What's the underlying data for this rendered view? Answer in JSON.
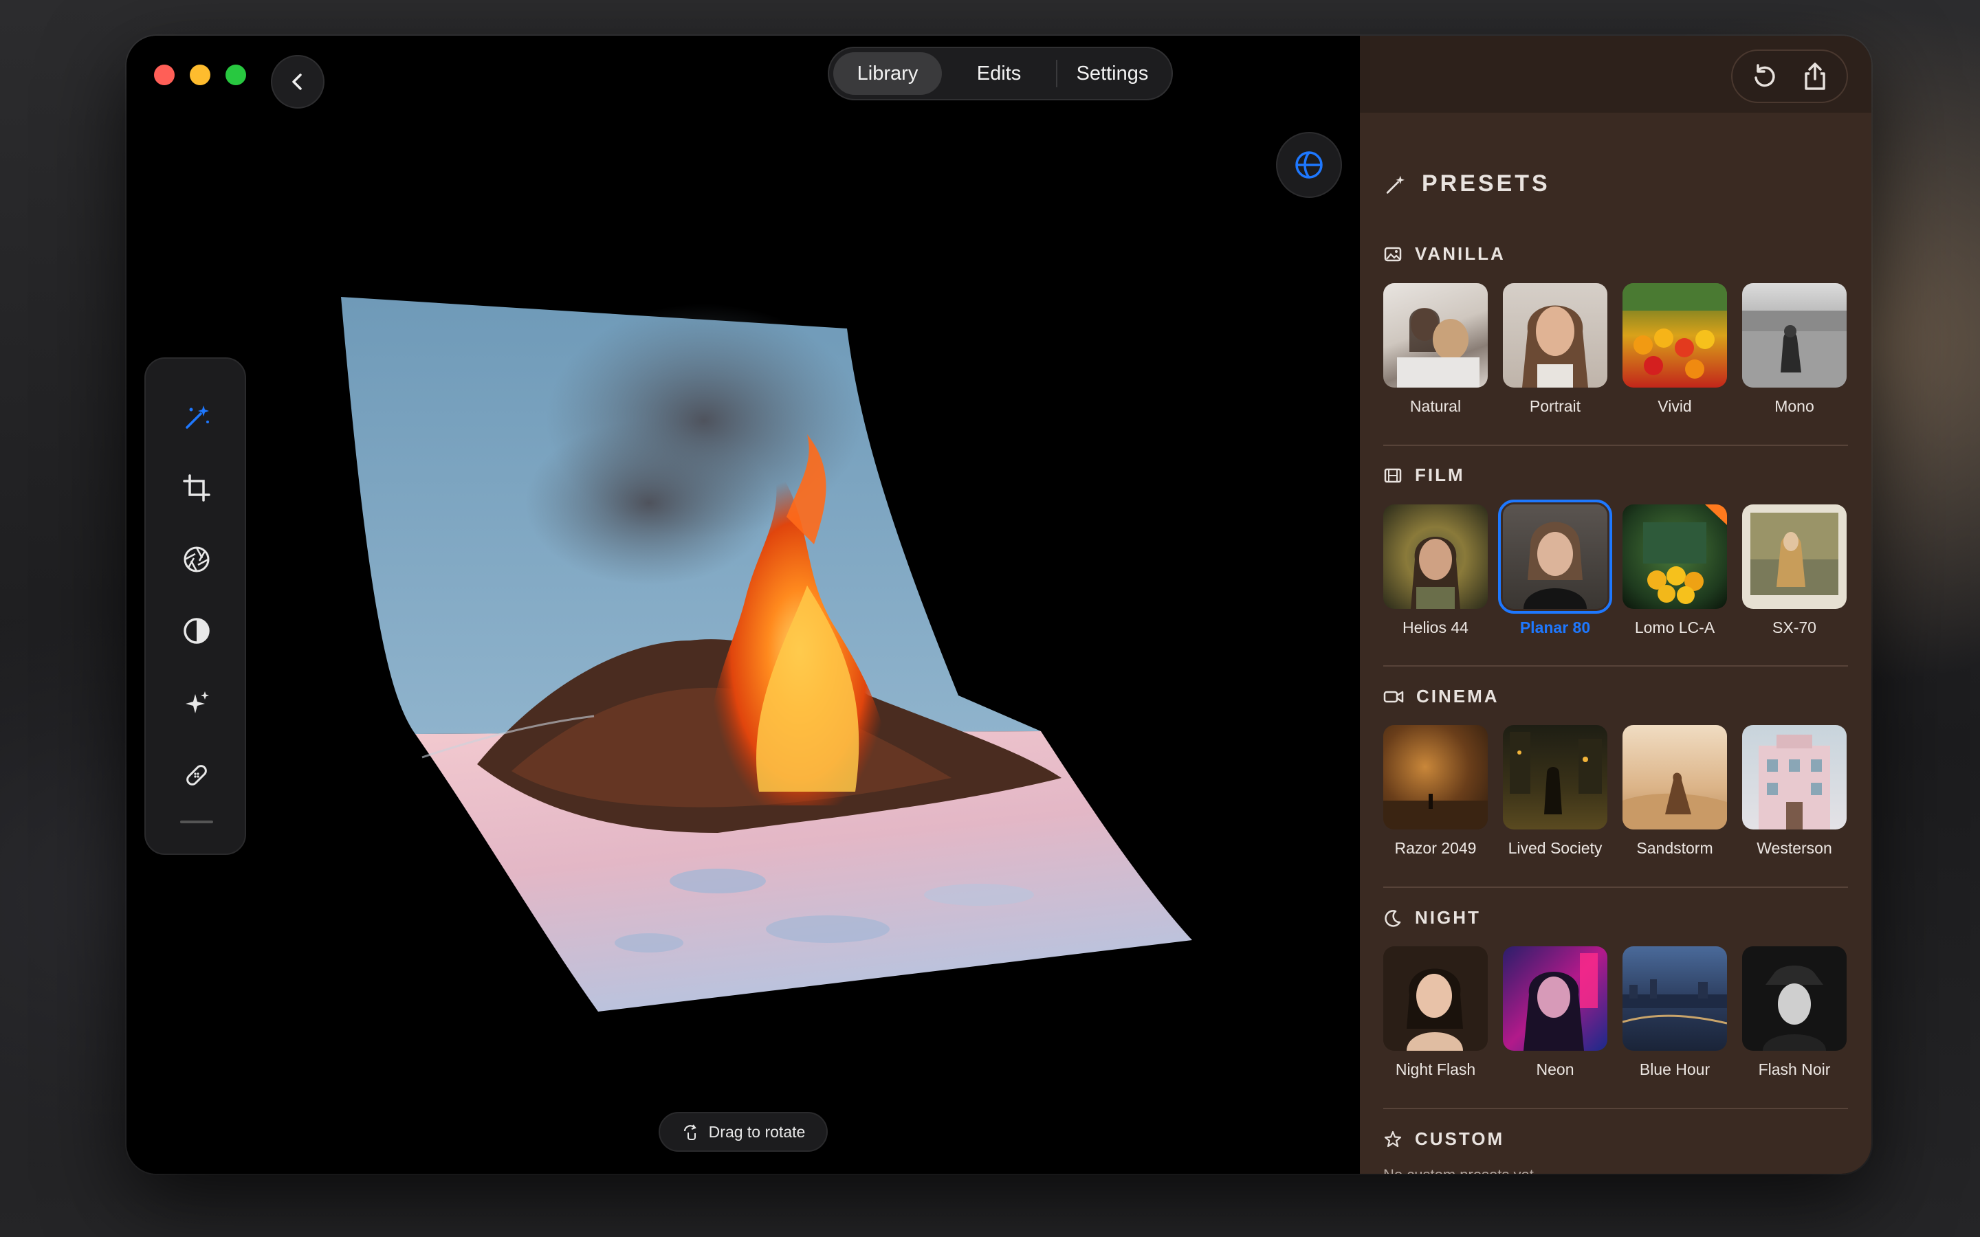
{
  "app": {
    "tabs": [
      {
        "label": "Library",
        "active": true
      },
      {
        "label": "Edits",
        "active": false
      },
      {
        "label": "Settings",
        "active": false
      }
    ],
    "hint": "Drag to rotate",
    "accent_color": "#1e78ff"
  },
  "toolbar": {
    "tools": [
      "magic-wand-icon",
      "crop-icon",
      "aperture-icon",
      "contrast-icon",
      "sparkles-icon",
      "bandage-icon"
    ],
    "active_tool": "magic-wand-icon"
  },
  "panel": {
    "title": "PRESETS",
    "sections": [
      {
        "title": "VANILLA",
        "icon": "photo-icon",
        "presets": [
          {
            "label": "Natural"
          },
          {
            "label": "Portrait"
          },
          {
            "label": "Vivid"
          },
          {
            "label": "Mono"
          }
        ]
      },
      {
        "title": "FILM",
        "icon": "film-icon",
        "presets": [
          {
            "label": "Helios 44"
          },
          {
            "label": "Planar 80",
            "selected": true
          },
          {
            "label": "Lomo LC-A"
          },
          {
            "label": "SX-70"
          }
        ]
      },
      {
        "title": "CINEMA",
        "icon": "video-camera-icon",
        "presets": [
          {
            "label": "Razor 2049"
          },
          {
            "label": "Lived Society"
          },
          {
            "label": "Sandstorm"
          },
          {
            "label": "Westerson"
          }
        ]
      },
      {
        "title": "NIGHT",
        "icon": "moon-icon",
        "presets": [
          {
            "label": "Night Flash"
          },
          {
            "label": "Neon"
          },
          {
            "label": "Blue Hour"
          },
          {
            "label": "Flash Noir"
          }
        ]
      }
    ],
    "custom": {
      "title": "CUSTOM",
      "icon": "star-icon",
      "empty_text": "No custom presets yet."
    }
  }
}
